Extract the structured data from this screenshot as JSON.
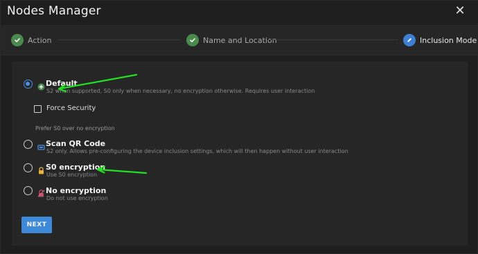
{
  "window": {
    "title": "Nodes Manager"
  },
  "stepper": {
    "steps": [
      {
        "label": "Action",
        "status": "done"
      },
      {
        "label": "Name and Location",
        "status": "done"
      },
      {
        "label": "Inclusion Mode",
        "status": "active"
      }
    ]
  },
  "options": [
    {
      "title": "Default",
      "desc": "S2 when supported, S0 only when necessary, no encryption otherwise. Requires user interaction",
      "selected": true,
      "icon": "plus-shield-icon"
    },
    {
      "title": "Scan QR Code",
      "desc": "S2 only. Allows pre-configuring the device inclusion settings, which will then happen without user interaction",
      "selected": false,
      "icon": "qr-scanner-icon"
    },
    {
      "title": "S0 encryption",
      "desc": "Use S0 encryption",
      "selected": false,
      "icon": "lock-icon"
    },
    {
      "title": "No encryption",
      "desc": "Do not use encryption",
      "selected": false,
      "icon": "unlock-icon"
    }
  ],
  "force_security": {
    "label": "Force Security",
    "checked": false
  },
  "hint": "Prefer S0 over no encryption",
  "next_label": "NEXT",
  "colors": {
    "accent": "#3f8ad8",
    "step_done": "#4a8a4d",
    "annotation_arrow": "#22e022"
  }
}
